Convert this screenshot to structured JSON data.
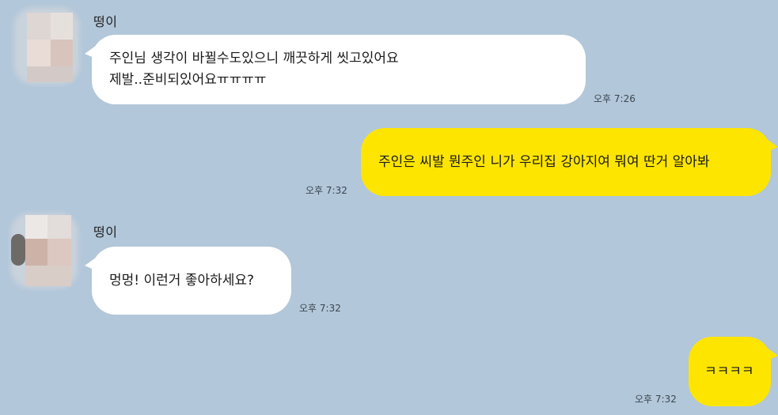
{
  "chat": {
    "background_color": "#b2c7d9",
    "received_bubble_color": "#ffffff",
    "sent_bubble_color": "#fee500",
    "messages": [
      {
        "sender": "떵이",
        "lines": [
          "주인님 생각이 바뀔수도있으니 깨끗하게 씻고있어요",
          "제발..준비되있어요ㅠㅠㅠㅠ"
        ],
        "time": "오후 7:26"
      },
      {
        "lines": [
          "주인은 씨발 뭔주인 니가 우리집 강아지여 뭐여 딴거 알아봐"
        ],
        "time": "오후 7:32"
      },
      {
        "sender": "떵이",
        "lines": [
          "멍멍! 이런거 좋아하세요?"
        ],
        "time": "오후 7:32"
      },
      {
        "lines": [
          "ㅋㅋㅋㅋ"
        ],
        "time": "오후 7:32"
      }
    ]
  }
}
